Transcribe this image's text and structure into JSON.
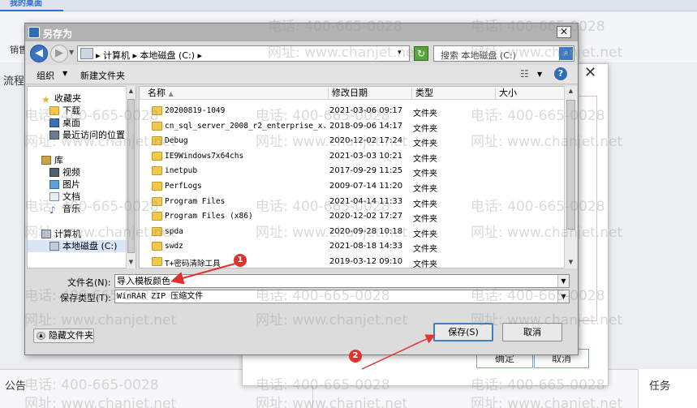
{
  "background": {
    "tab_label": "我的桌面",
    "sales_label": "销售",
    "flow_label": "流程",
    "notice_label": "公告",
    "task_label": "任务",
    "dialog_close": "✕",
    "dialog_ok": "确定",
    "dialog_cancel": "取消"
  },
  "dialog": {
    "title": "另存为",
    "close": "✕",
    "address": {
      "text": "▸ 计算机 ▸ 本地磁盘 (C:) ▸",
      "drop": "▾"
    },
    "search_placeholder": "搜索 本地磁盘 (C:)",
    "toolbar": {
      "organize": "组织",
      "new_folder": "新建文件夹",
      "help": "?"
    },
    "nav": {
      "favorites": "收藏夹",
      "favorites_items": [
        "下载",
        "桌面",
        "最近访问的位置"
      ],
      "libraries": "库",
      "library_items": [
        "视频",
        "图片",
        "文档",
        "音乐"
      ],
      "computer": "计算机",
      "computer_items": [
        "本地磁盘 (C:)"
      ]
    },
    "columns": {
      "name": "名称",
      "modified": "修改日期",
      "type": "类型",
      "size": "大小"
    },
    "files": [
      {
        "name": "20200819-1049",
        "modified": "2021-03-06 09:17",
        "type": "文件夹"
      },
      {
        "name": "cn_sql_server_2008_r2_enterprise_x...",
        "modified": "2018-09-06 14:17",
        "type": "文件夹"
      },
      {
        "name": "Debug",
        "modified": "2020-12-02 17:24",
        "type": "文件夹"
      },
      {
        "name": "IE9Windows7x64chs",
        "modified": "2021-03-03 10:21",
        "type": "文件夹"
      },
      {
        "name": "inetpub",
        "modified": "2017-09-29 11:25",
        "type": "文件夹"
      },
      {
        "name": "PerfLogs",
        "modified": "2009-07-14 11:20",
        "type": "文件夹"
      },
      {
        "name": "Program Files",
        "modified": "2021-04-14 11:33",
        "type": "文件夹"
      },
      {
        "name": "Program Files (x86)",
        "modified": "2020-12-02 17:27",
        "type": "文件夹"
      },
      {
        "name": "spda",
        "modified": "2020-09-28 10:18",
        "type": "文件夹"
      },
      {
        "name": "swdz",
        "modified": "2021-08-18 14:33",
        "type": "文件夹"
      },
      {
        "name": "T+密码清除工具",
        "modified": "2019-03-12 09:10",
        "type": "文件夹"
      }
    ],
    "filename_label": "文件名(N):",
    "filename_value": "导入模板颜色",
    "filetype_label": "保存类型(T):",
    "filetype_value": "WinRAR ZIP 压缩文件",
    "hide_folders": "隐藏文件夹",
    "save": "保存(S)",
    "cancel": "取消"
  },
  "annotations": {
    "marker_1": "1",
    "marker_2": "2",
    "color": "#e0332f"
  },
  "watermark": {
    "phone": "电话: 400-665-0028",
    "site": "网址: www.chanjet.net"
  }
}
